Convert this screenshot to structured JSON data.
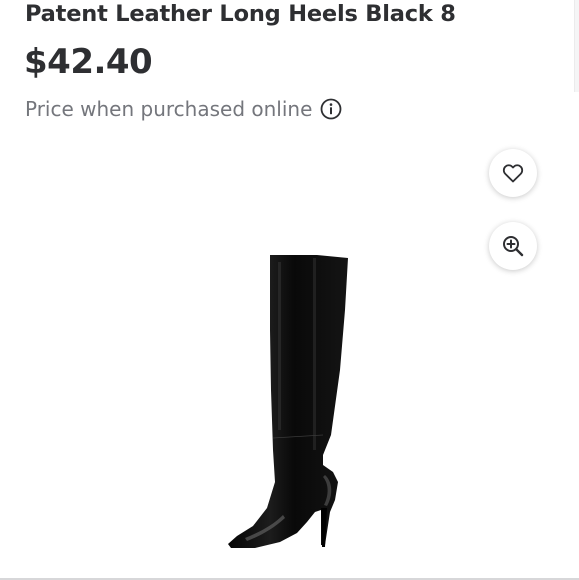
{
  "product": {
    "title": "Patent Leather Long Heels Black 8",
    "price": "$42.40",
    "price_note": "Price when purchased online"
  },
  "icons": {
    "info": "info-icon",
    "favorite": "heart-icon",
    "zoom": "zoom-in-icon"
  },
  "colors": {
    "text_primary": "#2e2f32",
    "text_secondary": "#74767c"
  }
}
